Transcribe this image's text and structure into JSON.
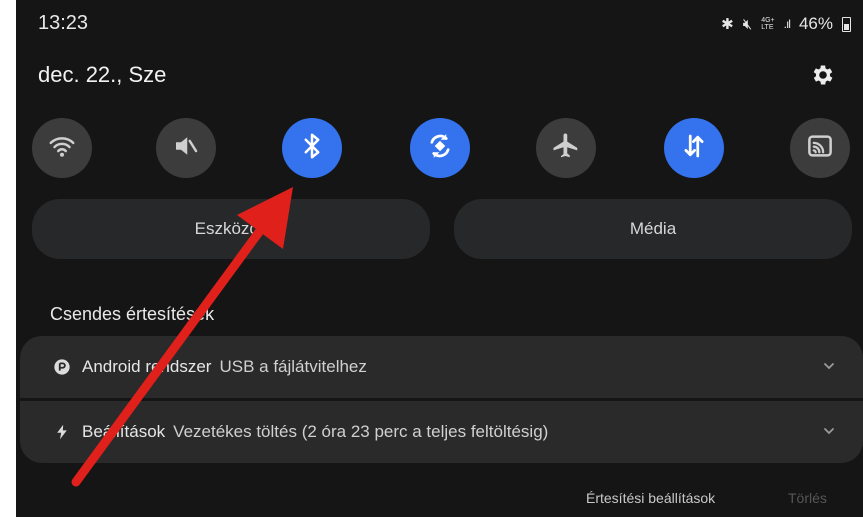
{
  "status_bar": {
    "time": "13:23",
    "battery": "46%",
    "network_top": "4G+",
    "network_bottom": "LTE",
    "icons": [
      "bluetooth-icon",
      "mute-icon",
      "network-type-icon",
      "signal-strength-icon",
      "battery-icon"
    ]
  },
  "header": {
    "date": "dec. 22., Sze",
    "settings_icon": "gear-icon"
  },
  "quick_settings": [
    {
      "name": "wifi",
      "icon": "wifi-icon",
      "active": false
    },
    {
      "name": "mute",
      "icon": "mute-icon",
      "active": false
    },
    {
      "name": "bluetooth",
      "icon": "bluetooth-icon",
      "active": true
    },
    {
      "name": "auto-rotate",
      "icon": "auto-rotate-icon",
      "active": true
    },
    {
      "name": "airplane-mode",
      "icon": "airplane-icon",
      "active": false
    },
    {
      "name": "mobile-data",
      "icon": "mobile-data-icon",
      "active": true
    },
    {
      "name": "cast",
      "icon": "cast-icon",
      "active": false
    }
  ],
  "output_buttons": {
    "devices": "Eszközök",
    "media": "Média"
  },
  "silent_notifications": {
    "title": "Csendes értesítések",
    "items": [
      {
        "icon": "android-system-icon",
        "app": "Android rendszer",
        "text": "USB a fájlátvitelhez"
      },
      {
        "icon": "charging-icon",
        "app": "Beállítások",
        "text": "Vezetékes töltés (2 óra 23 perc a teljes feltöltésig)"
      }
    ]
  },
  "footer": {
    "notification_settings": "Értesítési beállítások",
    "clear": "Törlés"
  },
  "colors": {
    "background": "#151515",
    "accent": "#3472ee",
    "tile_inactive": "#3c3c3c",
    "annotation_arrow": "#e0201b"
  }
}
